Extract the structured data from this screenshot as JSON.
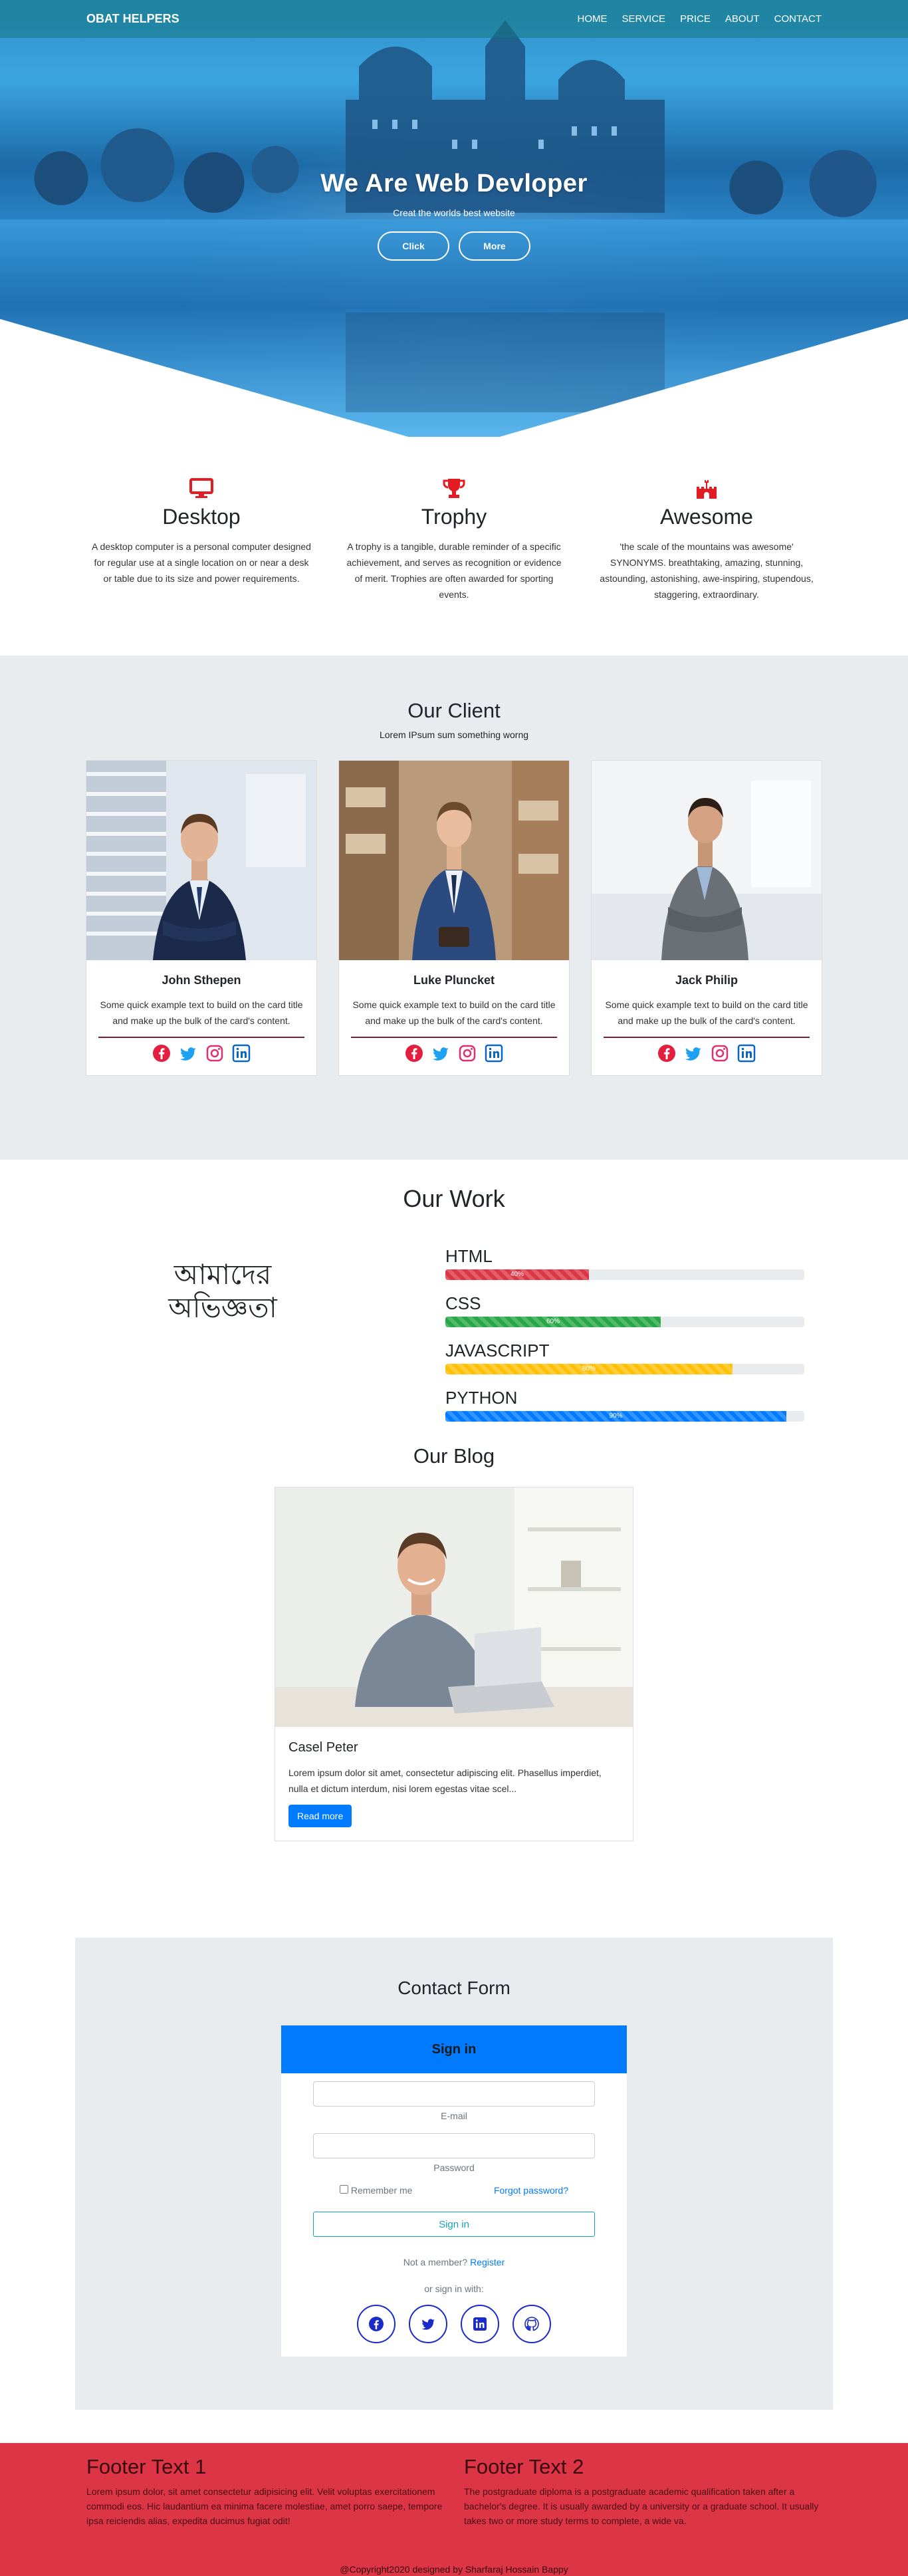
{
  "nav": {
    "brand": "OBAT HELPERS",
    "links": [
      "HOME",
      "SERVICE",
      "PRICE",
      "ABOUT",
      "CONTACT"
    ]
  },
  "hero": {
    "title": "We Are Web Devloper",
    "subtitle": "Creat the worlds best website",
    "buttons": [
      "Click",
      "More"
    ]
  },
  "features": [
    {
      "icon": "desktop-icon",
      "title": "Desktop",
      "text": "A desktop computer is a personal computer designed for regular use at a single location on or near a desk or table due to its size and power requirements."
    },
    {
      "icon": "trophy-icon",
      "title": "Trophy",
      "text": "A trophy is a tangible, durable reminder of a specific achievement, and serves as recognition or evidence of merit. Trophies are often awarded for sporting events."
    },
    {
      "icon": "castle-icon",
      "title": "Awesome",
      "text": "'the scale of the mountains was awesome' SYNONYMS. breathtaking, amazing, stunning, astounding, astonishing, awe-inspiring, stupendous, staggering, extraordinary."
    }
  ],
  "clients": {
    "title": "Our Client",
    "subtitle": "Lorem IPsum sum something worng",
    "cards": [
      {
        "name": "John Sthepen",
        "text": "Some quick example text to build on the card title and make up the bulk of the card's content."
      },
      {
        "name": "Luke Pluncket",
        "text": "Some quick example text to build on the card title and make up the bulk of the card's content."
      },
      {
        "name": "Jack Philip",
        "text": "Some quick example text to build on the card title and make up the bulk of the card's content."
      }
    ],
    "social_icons": [
      "facebook-icon",
      "twitter-icon",
      "instagram-icon",
      "linkedin-icon"
    ]
  },
  "work": {
    "title": "Our Work",
    "bangla_line1": "আমাদের",
    "bangla_line2": "অভিজ্ঞতা",
    "skills": [
      {
        "name": "HTML",
        "percent": 40,
        "label": "40%",
        "color": "#dc3545"
      },
      {
        "name": "CSS",
        "percent": 60,
        "label": "60%",
        "color": "#28a745"
      },
      {
        "name": "JAVASCRIPT",
        "percent": 80,
        "label": "80%",
        "color": "#ffc107"
      },
      {
        "name": "PYTHON",
        "percent": 95,
        "label": "90%",
        "color": "#007bff"
      }
    ]
  },
  "blog": {
    "title": "Our Blog",
    "post_title": "Casel Peter",
    "post_text": "Lorem ipsum dolor sit amet, consectetur adipiscing elit. Phasellus imperdiet, nulla et dictum interdum, nisi lorem egestas vitae scel...",
    "button": "Read more"
  },
  "contact": {
    "title": "Contact Form",
    "header": "Sign in",
    "email_label": "E-mail",
    "password_label": "Password",
    "remember": "Remember me",
    "forgot": "Forgot password?",
    "submit": "Sign in",
    "member_text": "Not a member?",
    "register": "Register",
    "or_sign": "or sign in with:",
    "social_icons": [
      "facebook-icon",
      "twitter-icon",
      "linkedin-icon",
      "github-icon"
    ]
  },
  "footer": {
    "col1_title": "Footer Text 1",
    "col1_text": "Lorem ipsum dolor, sit amet consectetur adipisicing elit. Velit voluptas exercitationem commodi eos. Hic laudantium ea minima facere molestiae, amet porro saepe, tempore ipsa reiciendis alias, expedita ducimus fugiat odit!",
    "col2_title": "Footer Text 2",
    "col2_text": "The postgraduate diploma is a postgraduate academic qualification taken after a bachelor's degree. It is usually awarded by a university or a graduate school. It usually takes two or more study terms to complete, a wide va.",
    "copyright": "@Copyright2020 designed by Sharfaraj Hossain Bappy"
  }
}
